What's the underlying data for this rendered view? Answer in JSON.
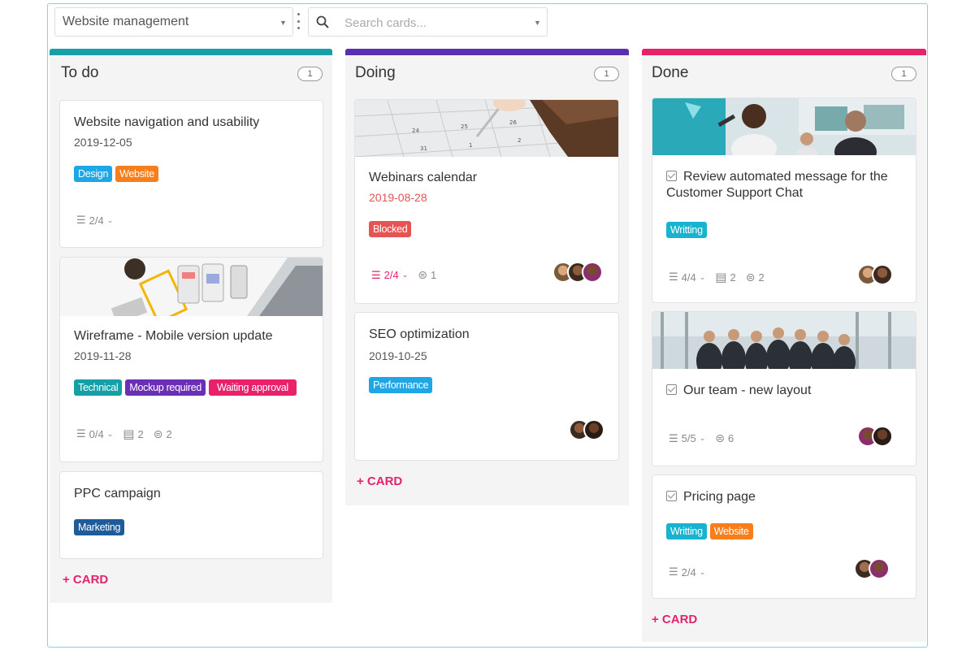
{
  "toolbar": {
    "board_name": "Website management",
    "search_placeholder": "Search cards..."
  },
  "colors": {
    "todo": "#14a0a6",
    "doing": "#5a2fb4",
    "done": "#e8216a",
    "accent": "#e0246e"
  },
  "columns": [
    {
      "title": "To do",
      "count": "1",
      "add_label": "+ CARD",
      "cards": [
        {
          "title": "Website navigation and usability",
          "date": "2019-12-05",
          "tags": [
            "Design",
            "Website"
          ],
          "checklist": "2/4"
        },
        {
          "title": "Wireframe - Mobile version update",
          "date": "2019-11-28",
          "tags": [
            "Technical",
            "Mockup required",
            "Waiting approval"
          ],
          "checklist": "0/4",
          "comments": "2",
          "attachments": "2"
        },
        {
          "title": "PPC campaign",
          "tags": [
            "Marketing"
          ]
        }
      ]
    },
    {
      "title": "Doing",
      "count": "1",
      "add_label": "+ CARD",
      "cards": [
        {
          "title": "Webinars calendar",
          "date": "2019-08-28",
          "tags": [
            "Blocked"
          ],
          "checklist": "2/4",
          "attachments": "1"
        },
        {
          "title": "SEO optimization",
          "date": "2019-10-25",
          "tags": [
            "Performance"
          ]
        }
      ]
    },
    {
      "title": "Done",
      "count": "1",
      "add_label": "+ CARD",
      "cards": [
        {
          "title": "Review automated message for the Customer Support Chat",
          "tags": [
            "Writting"
          ],
          "checklist": "4/4",
          "comments": "2",
          "attachments": "2"
        },
        {
          "title": "Our team - new layout",
          "checklist": "5/5",
          "attachments": "6"
        },
        {
          "title": "Pricing page",
          "tags": [
            "Writting",
            "Website"
          ],
          "checklist": "2/4"
        }
      ]
    }
  ]
}
